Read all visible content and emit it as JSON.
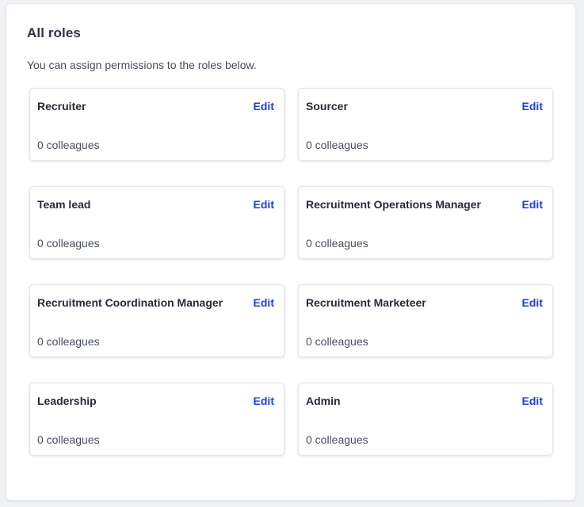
{
  "panel": {
    "title": "All roles",
    "subtitle": "You can assign permissions to the roles below."
  },
  "roles": [
    {
      "name": "Recruiter",
      "edit_label": "Edit",
      "count_text": "0 colleagues"
    },
    {
      "name": "Sourcer",
      "edit_label": "Edit",
      "count_text": "0 colleagues"
    },
    {
      "name": "Team lead",
      "edit_label": "Edit",
      "count_text": "0 colleagues"
    },
    {
      "name": "Recruitment Operations Manager",
      "edit_label": "Edit",
      "count_text": "0 colleagues"
    },
    {
      "name": "Recruitment Coordination Manager",
      "edit_label": "Edit",
      "count_text": "0 colleagues"
    },
    {
      "name": "Recruitment Marketeer",
      "edit_label": "Edit",
      "count_text": "0 colleagues"
    },
    {
      "name": "Leadership",
      "edit_label": "Edit",
      "count_text": "0 colleagues"
    },
    {
      "name": "Admin",
      "edit_label": "Edit",
      "count_text": "0 colleagues"
    }
  ],
  "colors": {
    "link": "#1f3ee0",
    "heading": "#2e3447",
    "text": "#474d5c",
    "page_background": "#f0f1f4"
  }
}
